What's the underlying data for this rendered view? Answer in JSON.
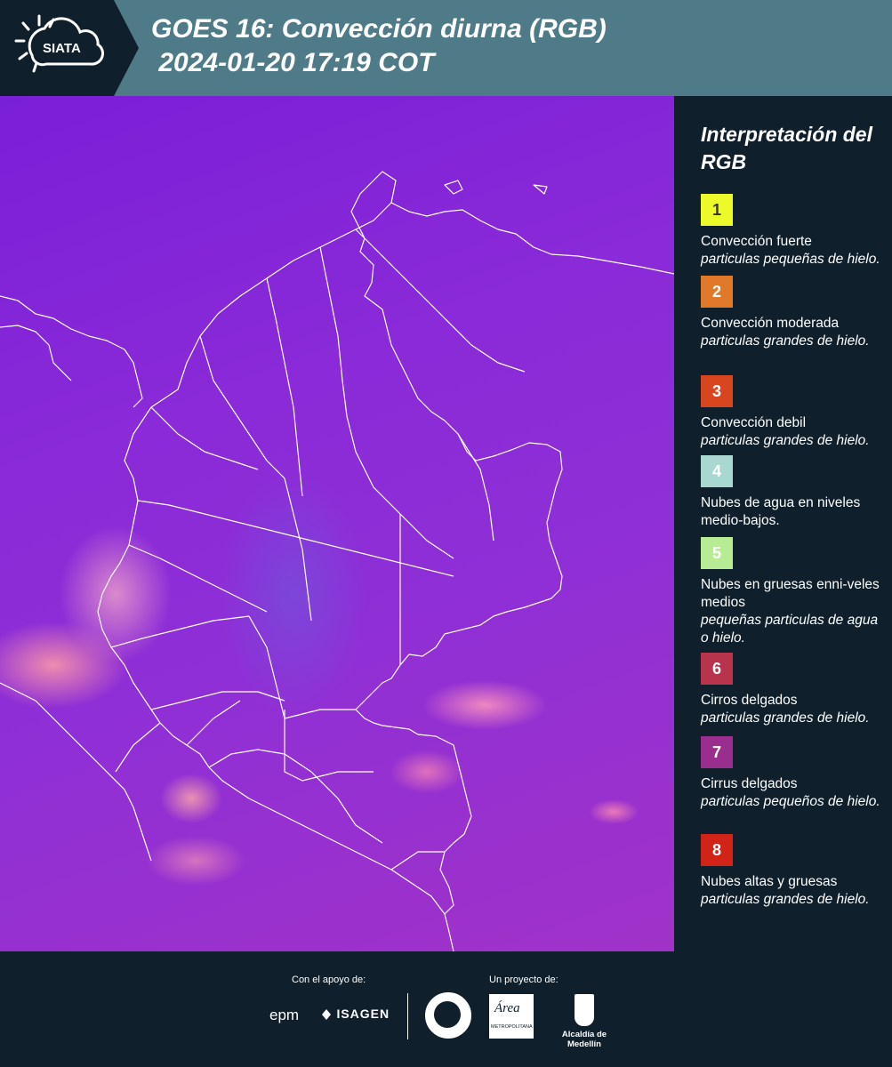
{
  "header": {
    "logo_text": "SIATA",
    "title": "GOES 16: Convección diurna (RGB)\n 2024-01-20 17:19 COT"
  },
  "legend": {
    "title": "Interpretación del RGB",
    "items": [
      {
        "num": "1",
        "color": "#ecfa2a",
        "num_color": "#333333",
        "title": "Convección fuerte",
        "subtitle": "particulas pequeñas de hielo."
      },
      {
        "num": "2",
        "color": "#e07a2a",
        "num_color": "#ffffff",
        "title": "Convección moderada",
        "subtitle": "particulas grandes de hielo."
      },
      {
        "num": "3",
        "color": "#d8461f",
        "num_color": "#ffffff",
        "title": "Convección debil",
        "subtitle": "particulas grandes de hielo."
      },
      {
        "num": "4",
        "color": "#a8d8cf",
        "num_color": "#ffffff",
        "title": "Nubes de agua en niveles medio-bajos.",
        "subtitle": ""
      },
      {
        "num": "5",
        "color": "#b8ec94",
        "num_color": "#ffffff",
        "title": "Nubes en gruesas enni-veles medios",
        "subtitle": "pequeñas particulas de agua o hielo."
      },
      {
        "num": "6",
        "color": "#b8344c",
        "num_color": "#ffffff",
        "title": "Cirros delgados",
        "subtitle": "particulas grandes de hielo."
      },
      {
        "num": "7",
        "color": "#9a2e8e",
        "num_color": "#ffffff",
        "title": "Cirrus delgados",
        "subtitle": "particulas pequeños de hielo."
      },
      {
        "num": "8",
        "color": "#d22318",
        "num_color": "#ffffff",
        "title": "Nubes altas y gruesas",
        "subtitle": "particulas grandes de hielo."
      }
    ]
  },
  "footer": {
    "support_label": "Con el apoyo de:",
    "project_label": "Un proyecto de:",
    "sponsor_epm": "epm",
    "sponsor_isagen": "ISAGEN",
    "metro_name": "Área",
    "metro_caption": "METROPOLITANA",
    "alcaldia": "Alcaldía de Medellín"
  }
}
